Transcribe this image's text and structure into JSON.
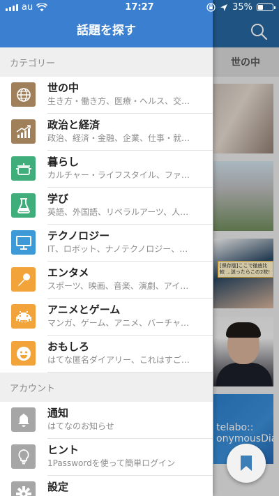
{
  "status_bar": {
    "carrier": "au",
    "time": "17:27",
    "battery": "35%",
    "battery_level": 0.35
  },
  "background_app": {
    "tab_label": "世の中",
    "card_tag_text": "[保存版]ここで徹底比較\n...迷ったらこの2枚!",
    "card_label": "telabo::\nonymousDiar"
  },
  "drawer": {
    "title": "話題を探す",
    "category_header": "カテゴリー",
    "account_header": "アカウント",
    "categories": [
      {
        "title": "世の中",
        "subtitle": "生き方・働き方、医療・ヘルス、交…",
        "icon": "globe-icon",
        "color": "#a0805a"
      },
      {
        "title": "政治と経済",
        "subtitle": "政治、経済・金融、企業、仕事・就…",
        "icon": "chart-icon",
        "color": "#a0805a"
      },
      {
        "title": "暮らし",
        "subtitle": "カルチャー・ライフスタイル、ファ…",
        "icon": "pot-icon",
        "color": "#3fae7a"
      },
      {
        "title": "学び",
        "subtitle": "英語、外国語、リベラルアーツ、人…",
        "icon": "flask-icon",
        "color": "#3fae7a"
      },
      {
        "title": "テクノロジー",
        "subtitle": "IT、ロボット、ナノテクノロジー、…",
        "icon": "monitor-icon",
        "color": "#3d9ad6"
      },
      {
        "title": "エンタメ",
        "subtitle": "スポーツ、映画、音楽、演劇、アイ…",
        "icon": "microphone-icon",
        "color": "#f2a43a"
      },
      {
        "title": "アニメとゲーム",
        "subtitle": "マンガ、ゲーム、アニメ、バーチャ…",
        "icon": "space-invader-icon",
        "color": "#f2a43a"
      },
      {
        "title": "おもしろ",
        "subtitle": "はてな匿名ダイアリー、これはすご…",
        "icon": "smiley-icon",
        "color": "#f2a43a"
      }
    ],
    "account": [
      {
        "title": "通知",
        "subtitle": "はてなのお知らせ",
        "icon": "bell-icon",
        "color": "#a6a6a6"
      },
      {
        "title": "ヒント",
        "subtitle": "1Passwordを使って簡単ログイン",
        "icon": "lightbulb-icon",
        "color": "#a6a6a6"
      },
      {
        "title": "設定",
        "subtitle": "",
        "icon": "gear-icon",
        "color": "#a6a6a6"
      }
    ]
  }
}
